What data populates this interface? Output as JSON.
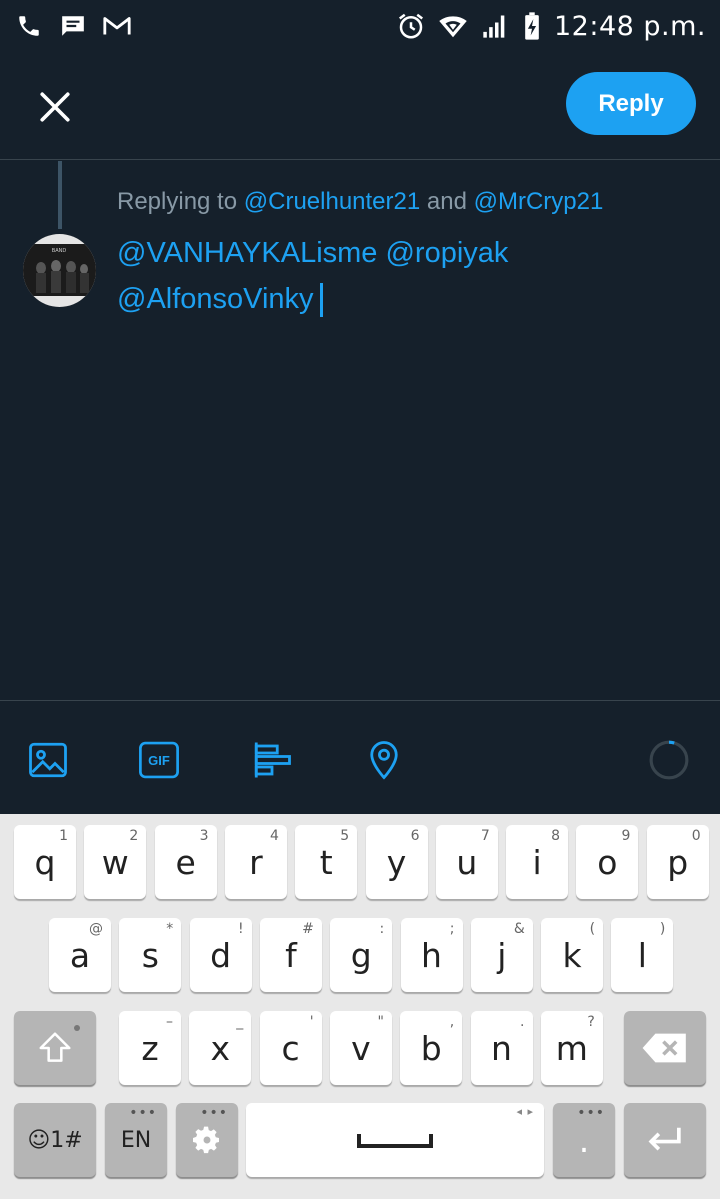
{
  "status_bar": {
    "time": "12:48 p.m.",
    "icons_left": [
      "phone-icon",
      "message-icon",
      "gmail-icon"
    ],
    "icons_right": [
      "alarm-icon",
      "wifi-icon",
      "signal-icon",
      "battery-charging-icon"
    ]
  },
  "header": {
    "close_icon": "close-icon",
    "reply_label": "Reply"
  },
  "compose": {
    "replying_prefix": "Replying to ",
    "replying_user1": "@Cruelhunter21",
    "replying_and": " and ",
    "replying_user2": "@MrCryp21",
    "line1": "@VANHAYKALisme @ropiyak",
    "line2": "@AlfonsoVinky"
  },
  "toolbar": {
    "items": [
      "image-icon",
      "gif-icon",
      "poll-icon",
      "location-icon"
    ],
    "gif_text": "GIF",
    "progress_icon": "character-count-ring"
  },
  "keyboard": {
    "row1": [
      {
        "k": "q",
        "s": "1"
      },
      {
        "k": "w",
        "s": "2"
      },
      {
        "k": "e",
        "s": "3"
      },
      {
        "k": "r",
        "s": "4"
      },
      {
        "k": "t",
        "s": "5"
      },
      {
        "k": "y",
        "s": "6"
      },
      {
        "k": "u",
        "s": "7"
      },
      {
        "k": "i",
        "s": "8"
      },
      {
        "k": "o",
        "s": "9"
      },
      {
        "k": "p",
        "s": "0"
      }
    ],
    "row2": [
      {
        "k": "a",
        "s": "@"
      },
      {
        "k": "s",
        "s": "*"
      },
      {
        "k": "d",
        "s": "!"
      },
      {
        "k": "f",
        "s": "#"
      },
      {
        "k": "g",
        "s": ":"
      },
      {
        "k": "h",
        "s": ";"
      },
      {
        "k": "j",
        "s": "&"
      },
      {
        "k": "k",
        "s": "("
      },
      {
        "k": "l",
        "s": ")"
      }
    ],
    "row3": [
      {
        "k": "z",
        "s": "–"
      },
      {
        "k": "x",
        "s": "_"
      },
      {
        "k": "c",
        "s": "'"
      },
      {
        "k": "v",
        "s": "\""
      },
      {
        "k": "b",
        "s": ","
      },
      {
        "k": "n",
        "s": "."
      },
      {
        "k": "m",
        "s": "?"
      }
    ],
    "emoji_label": "☺1#",
    "lang_label": "EN",
    "period_label": ".",
    "space_arrows": "◂ ▸"
  }
}
